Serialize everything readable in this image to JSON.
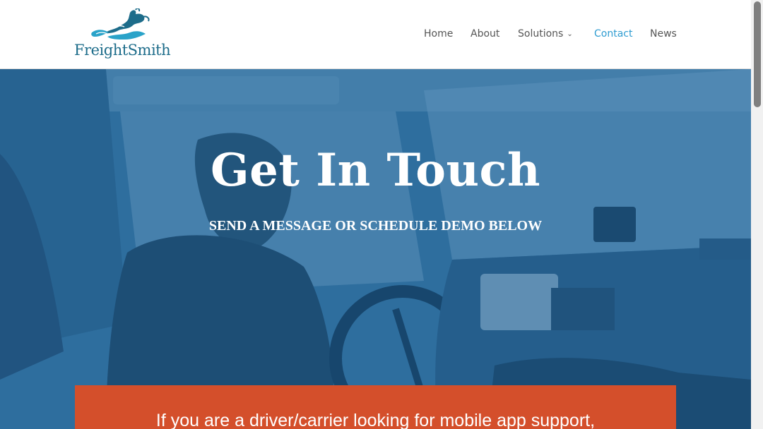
{
  "brand": {
    "name": "FreightSmith"
  },
  "nav": {
    "items": [
      {
        "label": "Home",
        "active": false
      },
      {
        "label": "About",
        "active": false
      },
      {
        "label": "Solutions",
        "active": false,
        "has_dropdown": true
      },
      {
        "label": "Contact",
        "active": true
      },
      {
        "label": "News",
        "active": false
      }
    ]
  },
  "hero": {
    "title": "Get In Touch",
    "subtitle": "SEND A MESSAGE OR SCHEDULE DEMO BELOW"
  },
  "banner": {
    "text": "If you are a driver/carrier looking for mobile app support,"
  },
  "icons": {
    "dropdown": "chevron-down-icon",
    "logo": "rabbit-logo-icon"
  },
  "colors": {
    "brand_blue": "#1d6c8a",
    "nav_active": "#2e9cd1",
    "nav_text": "#555555",
    "hero_tint": "#2a6a98",
    "banner_bg": "#d44f2b"
  }
}
